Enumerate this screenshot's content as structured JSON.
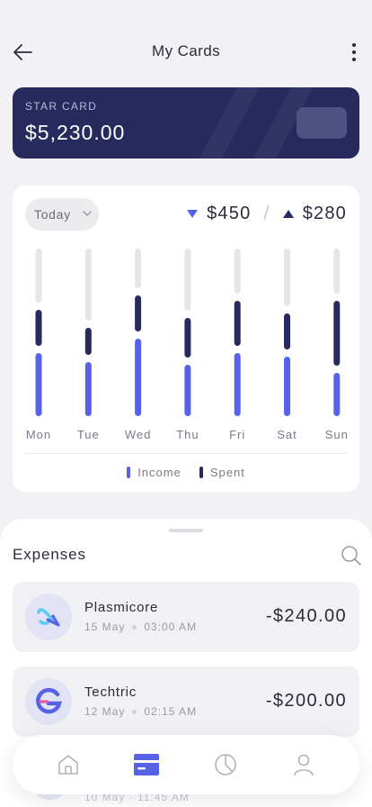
{
  "header": {
    "title": "My Cards",
    "back_icon": "arrow-left-icon",
    "more_icon": "more-vertical-icon"
  },
  "card": {
    "name": "STAR CARD",
    "balance": "$5,230.00",
    "color": "#262a5c"
  },
  "stats": {
    "period": "Today",
    "income_total": "$450",
    "spent_total": "$280",
    "separator": "/",
    "income_color": "#5762e6",
    "spent_color": "#262a5c",
    "track_color": "#e6e6e9"
  },
  "chart_data": {
    "type": "bar",
    "categories": [
      "Mon",
      "Tue",
      "Wed",
      "Thu",
      "Fri",
      "Sat",
      "Sun"
    ],
    "series": [
      {
        "name": "Income",
        "values": [
          70,
          60,
          86,
          57,
          70,
          66,
          48
        ]
      },
      {
        "name": "Spent",
        "values": [
          40,
          30,
          40,
          44,
          50,
          40,
          72
        ]
      }
    ],
    "stacked": true,
    "legend": [
      "Income",
      "Spent"
    ],
    "legend_position": "bottom",
    "title": "",
    "xlabel": "",
    "ylabel": ""
  },
  "expenses": {
    "title": "Expenses",
    "search_icon": "search-icon",
    "items": [
      {
        "name": "Plasmicore",
        "date": "15 May",
        "time": "03:00 AM",
        "amount": "-$240.00",
        "logo": "plasmicore-logo-icon"
      },
      {
        "name": "Techtric",
        "date": "12 May",
        "time": "02:15 AM",
        "amount": "-$200.00",
        "logo": "techtric-logo-icon"
      }
    ],
    "peek": "10 May · 11:45 AM"
  },
  "nav": {
    "items": [
      {
        "icon": "home-icon",
        "active": false
      },
      {
        "icon": "card-icon",
        "active": true
      },
      {
        "icon": "pie-chart-icon",
        "active": false
      },
      {
        "icon": "user-icon",
        "active": false
      }
    ]
  }
}
